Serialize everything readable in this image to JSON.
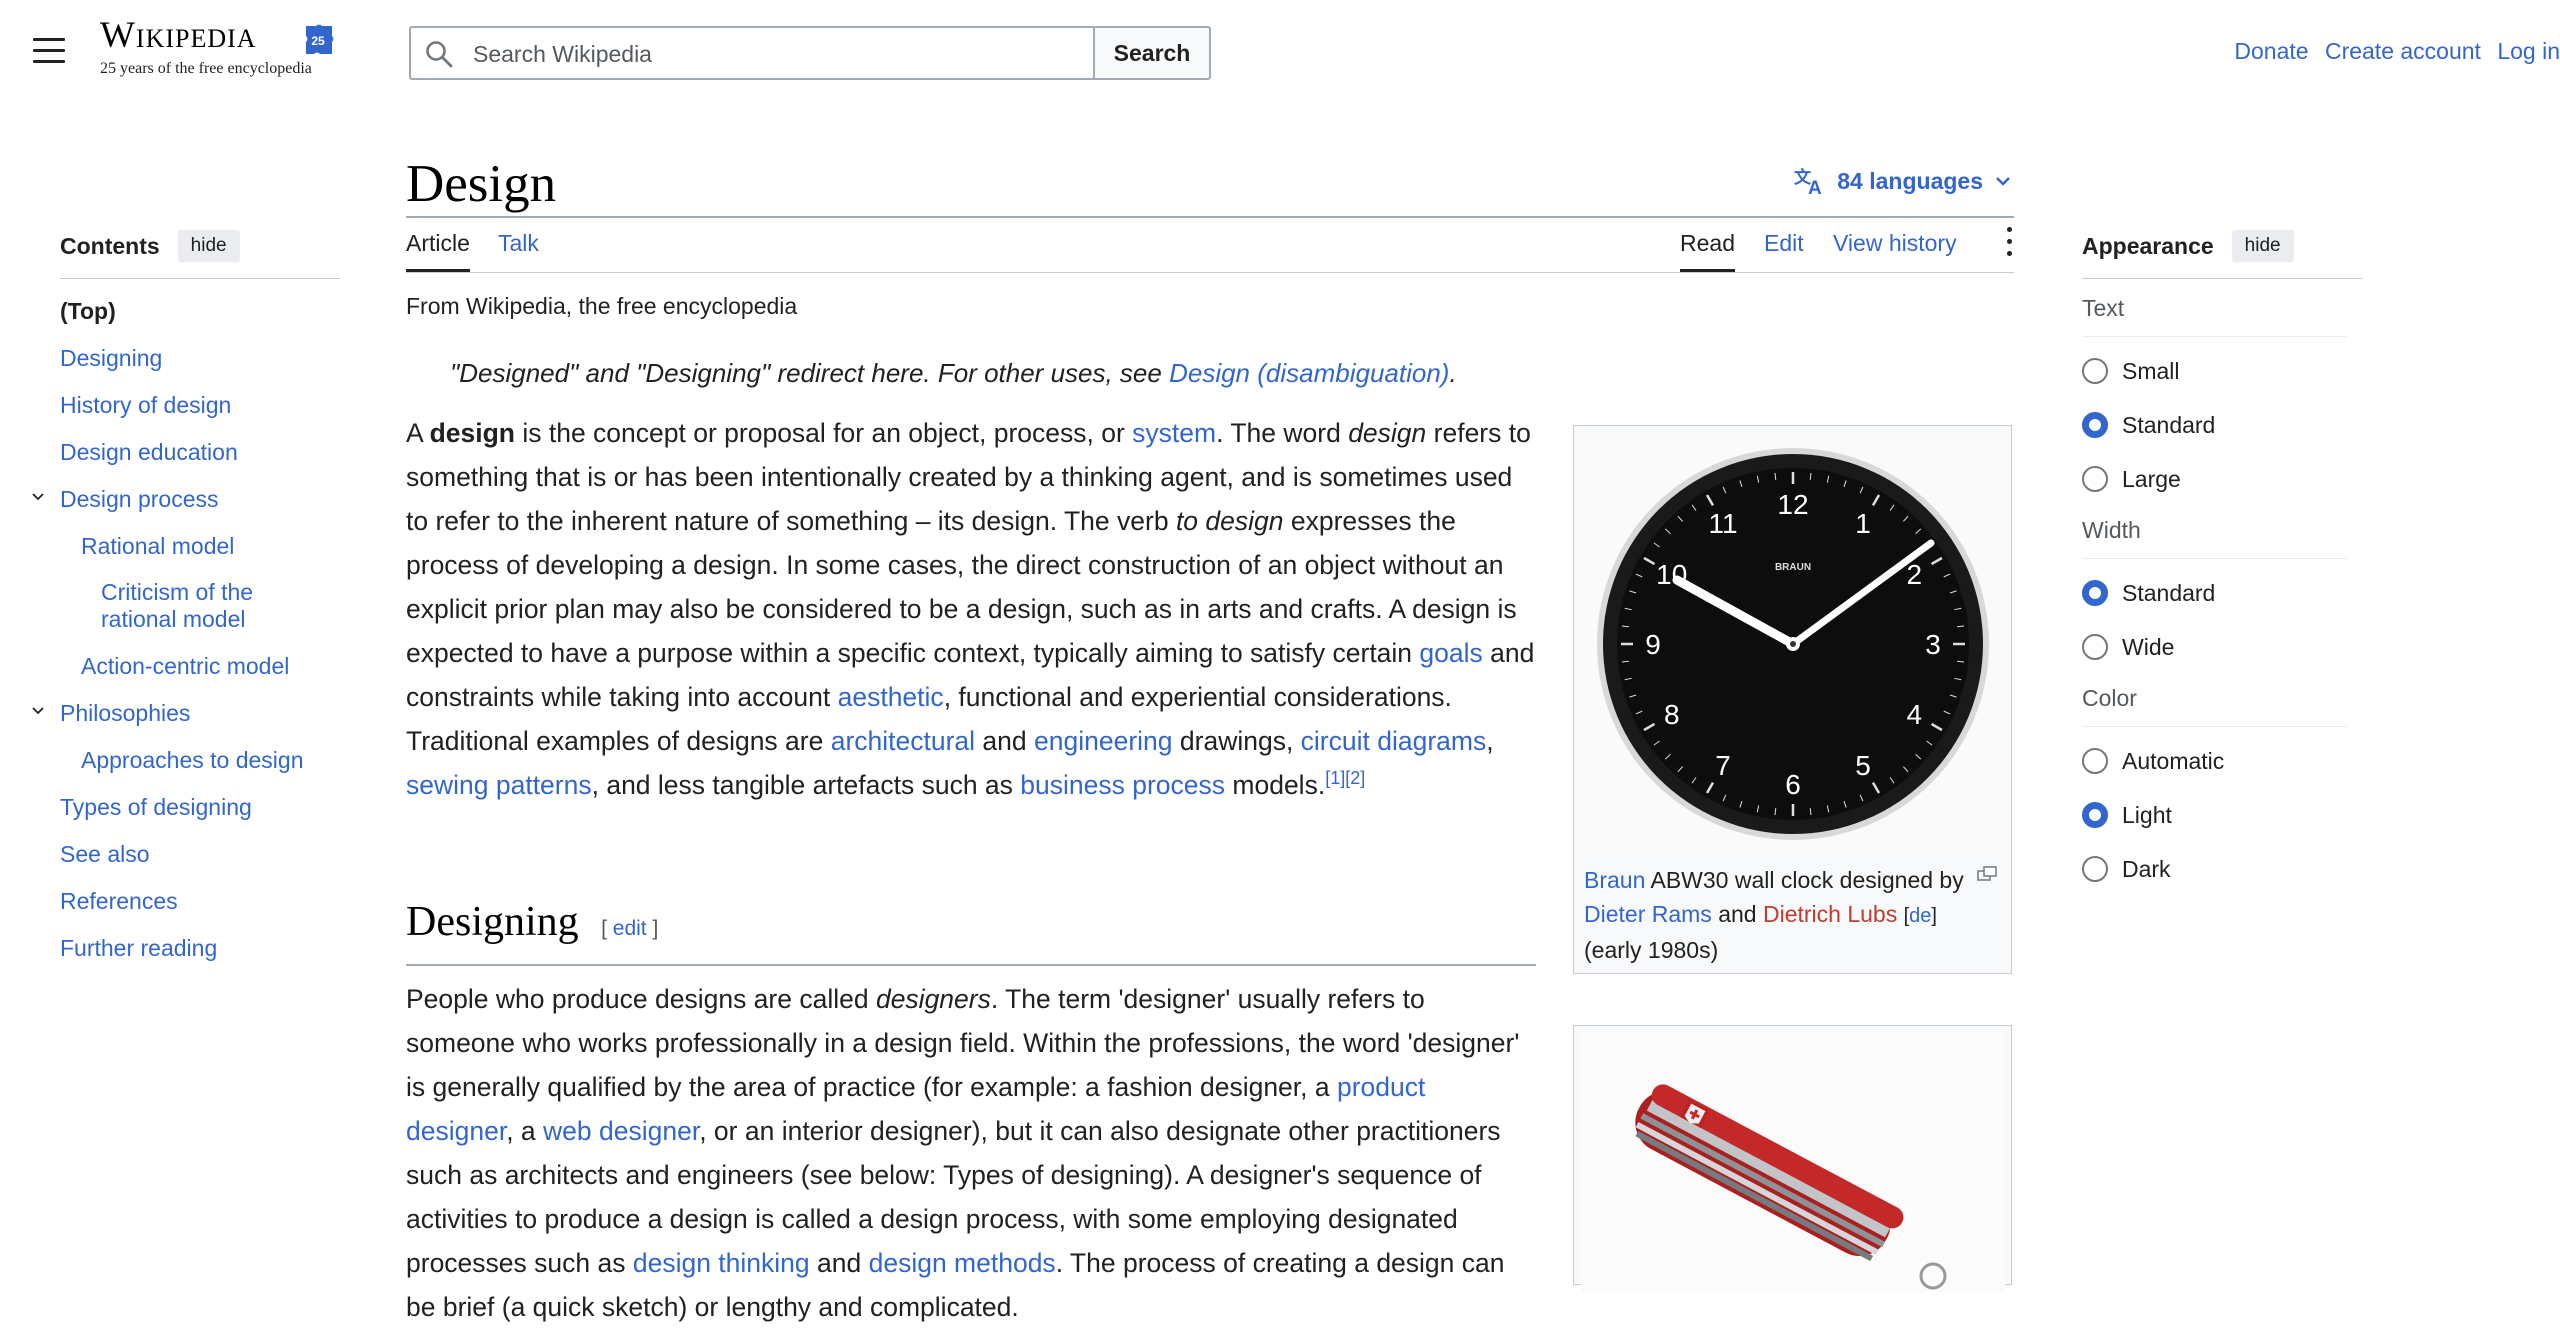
{
  "header": {
    "logo_word": "Wikipedia",
    "logo_tagline": "25 years of the free encyclopedia",
    "search_placeholder": "Search Wikipedia",
    "search_button": "Search",
    "nav": [
      "Donate",
      "Create account",
      "Log in"
    ]
  },
  "toc": {
    "title": "Contents",
    "hide": "hide",
    "items": [
      {
        "label": "(Top)",
        "level": 1
      },
      {
        "label": "Designing",
        "level": 1
      },
      {
        "label": "History of design",
        "level": 1
      },
      {
        "label": "Design education",
        "level": 1
      },
      {
        "label": "Design process",
        "level": 1,
        "expandable": true
      },
      {
        "label": "Rational model",
        "level": 2
      },
      {
        "label": "Criticism of the rational model",
        "level": 3
      },
      {
        "label": "Action-centric model",
        "level": 2
      },
      {
        "label": "Philosophies",
        "level": 1,
        "expandable": true
      },
      {
        "label": "Approaches to design",
        "level": 2
      },
      {
        "label": "Types of designing",
        "level": 1
      },
      {
        "label": "See also",
        "level": 1
      },
      {
        "label": "References",
        "level": 1
      },
      {
        "label": "Further reading",
        "level": 1
      }
    ]
  },
  "article": {
    "title": "Design",
    "languages": "84 languages",
    "tabs_left": [
      "Article",
      "Talk"
    ],
    "tabs_right": [
      "Read",
      "Edit",
      "View history"
    ],
    "from": "From Wikipedia, the free encyclopedia",
    "hatnote_text": "\"Designed\" and \"Designing\" redirect here. For other uses, see ",
    "hatnote_link": "Design (disambiguation)",
    "section1_title": "Designing",
    "section1_edit": "edit"
  },
  "figure1": {
    "caption_link1": "Braun",
    "caption_text1": " ABW30 wall clock designed by ",
    "caption_link2": "Dieter Rams",
    "caption_text2": " and ",
    "caption_redlink": "Dietrich Lubs",
    "caption_lang": "de",
    "caption_text3": " (early 1980s)",
    "clock_brand": "BRAUN",
    "clock_numbers": [
      "12",
      "1",
      "2",
      "3",
      "4",
      "5",
      "6",
      "7",
      "8",
      "9",
      "10",
      "11"
    ]
  },
  "appearance": {
    "title": "Appearance",
    "hide": "hide",
    "groups": [
      {
        "label": "Text",
        "options": [
          "Small",
          "Standard",
          "Large"
        ],
        "selected": "Standard"
      },
      {
        "label": "Width",
        "options": [
          "Standard",
          "Wide"
        ],
        "selected": "Standard"
      },
      {
        "label": "Color",
        "options": [
          "Automatic",
          "Light",
          "Dark"
        ],
        "selected": "Light"
      }
    ]
  },
  "colors": {
    "link": "#3366cc",
    "redlink": "#bf3c2c",
    "text": "#202122"
  }
}
